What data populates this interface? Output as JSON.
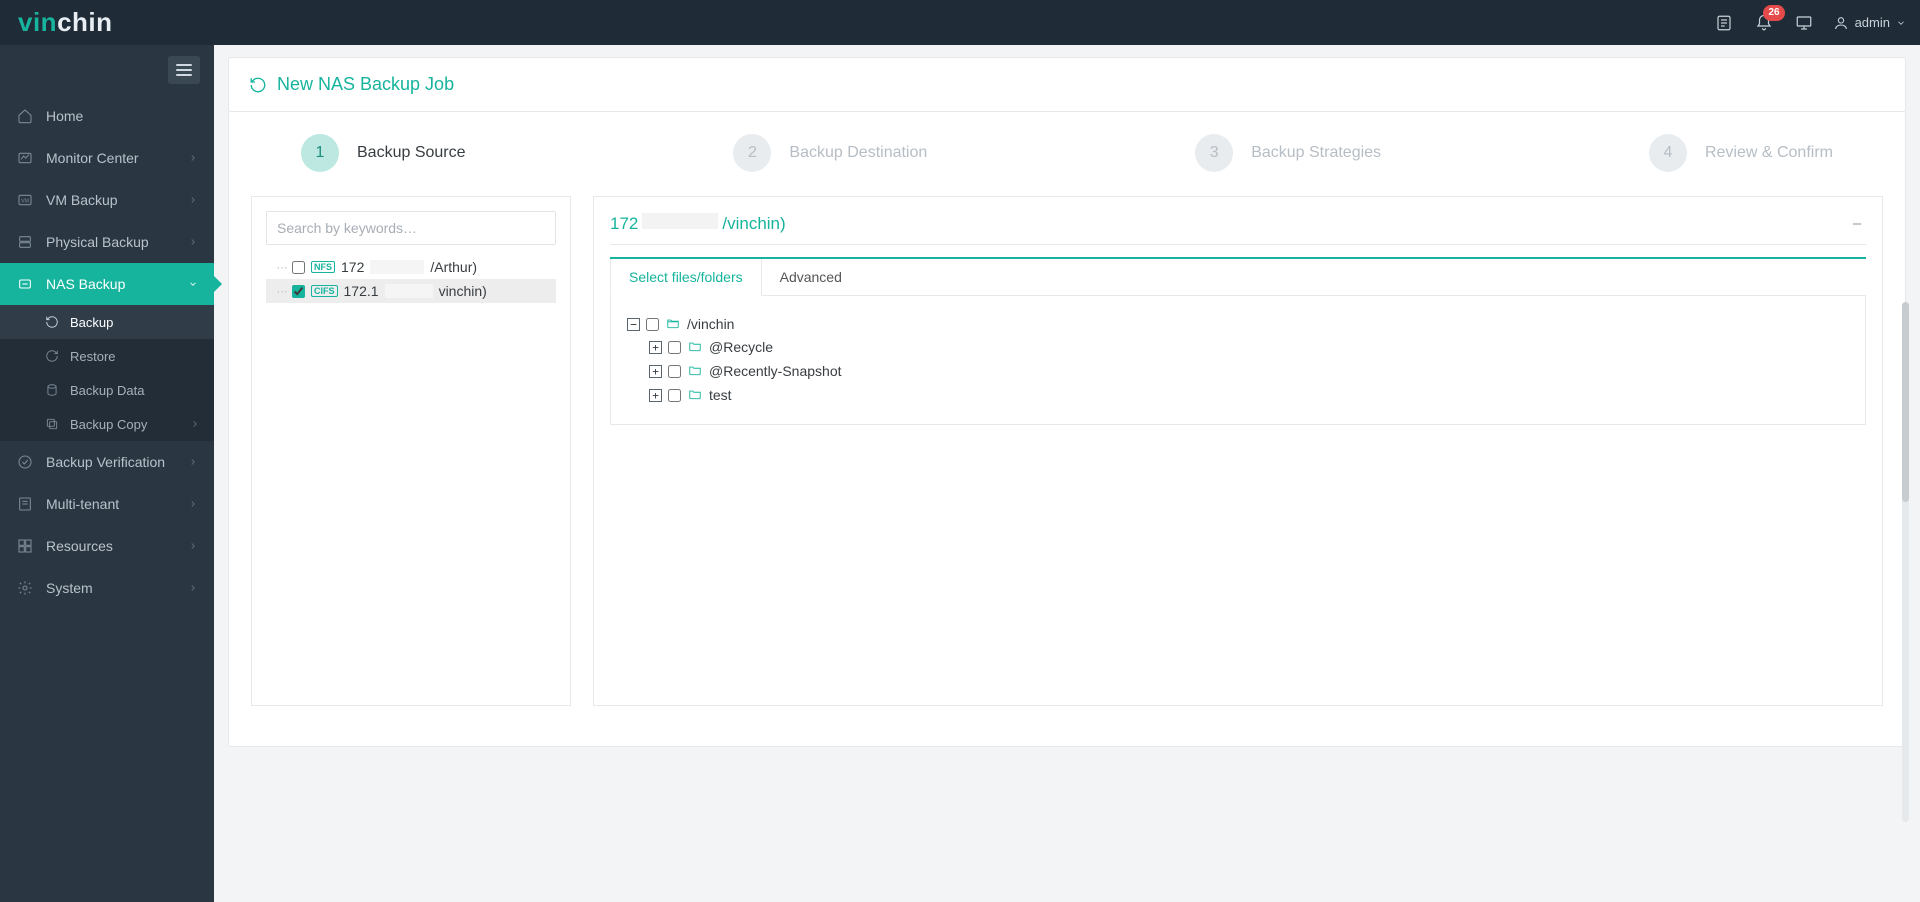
{
  "brand": {
    "part1": "vin",
    "part2": "chin"
  },
  "topbar": {
    "notifications_count": "26",
    "user_label": "admin"
  },
  "sidebar": {
    "items": [
      {
        "label": "Home",
        "icon": "home"
      },
      {
        "label": "Monitor Center",
        "icon": "monitor"
      },
      {
        "label": "VM Backup",
        "icon": "vm"
      },
      {
        "label": "Physical Backup",
        "icon": "physical"
      },
      {
        "label": "NAS Backup",
        "icon": "nas"
      },
      {
        "label": "Backup Verification",
        "icon": "verify"
      },
      {
        "label": "Multi-tenant",
        "icon": "tenant"
      },
      {
        "label": "Resources",
        "icon": "resources"
      },
      {
        "label": "System",
        "icon": "system"
      }
    ],
    "sub_nas": [
      {
        "label": "Backup",
        "icon": "refresh"
      },
      {
        "label": "Restore",
        "icon": "restore"
      },
      {
        "label": "Backup Data",
        "icon": "data"
      },
      {
        "label": "Backup Copy",
        "icon": "copy"
      }
    ]
  },
  "page": {
    "title": "New NAS Backup Job",
    "steps": [
      {
        "num": "1",
        "label": "Backup Source"
      },
      {
        "num": "2",
        "label": "Backup Destination"
      },
      {
        "num": "3",
        "label": "Backup Strategies"
      },
      {
        "num": "4",
        "label": "Review & Confirm"
      }
    ]
  },
  "source": {
    "search_placeholder": "Search by keywords…",
    "shares": [
      {
        "proto": "NFS",
        "prefix": "172",
        "suffix": "/Arthur)",
        "checked": false
      },
      {
        "proto": "CIFS",
        "prefix": "172.1",
        "suffix": "vinchin)",
        "checked": true
      }
    ]
  },
  "target": {
    "title_prefix": "172",
    "title_suffix": "/vinchin)",
    "tabs": {
      "files": "Select files/folders",
      "advanced": "Advanced"
    },
    "root": "/vinchin",
    "children": [
      {
        "name": "@Recycle"
      },
      {
        "name": "@Recently-Snapshot"
      },
      {
        "name": "test"
      }
    ]
  }
}
